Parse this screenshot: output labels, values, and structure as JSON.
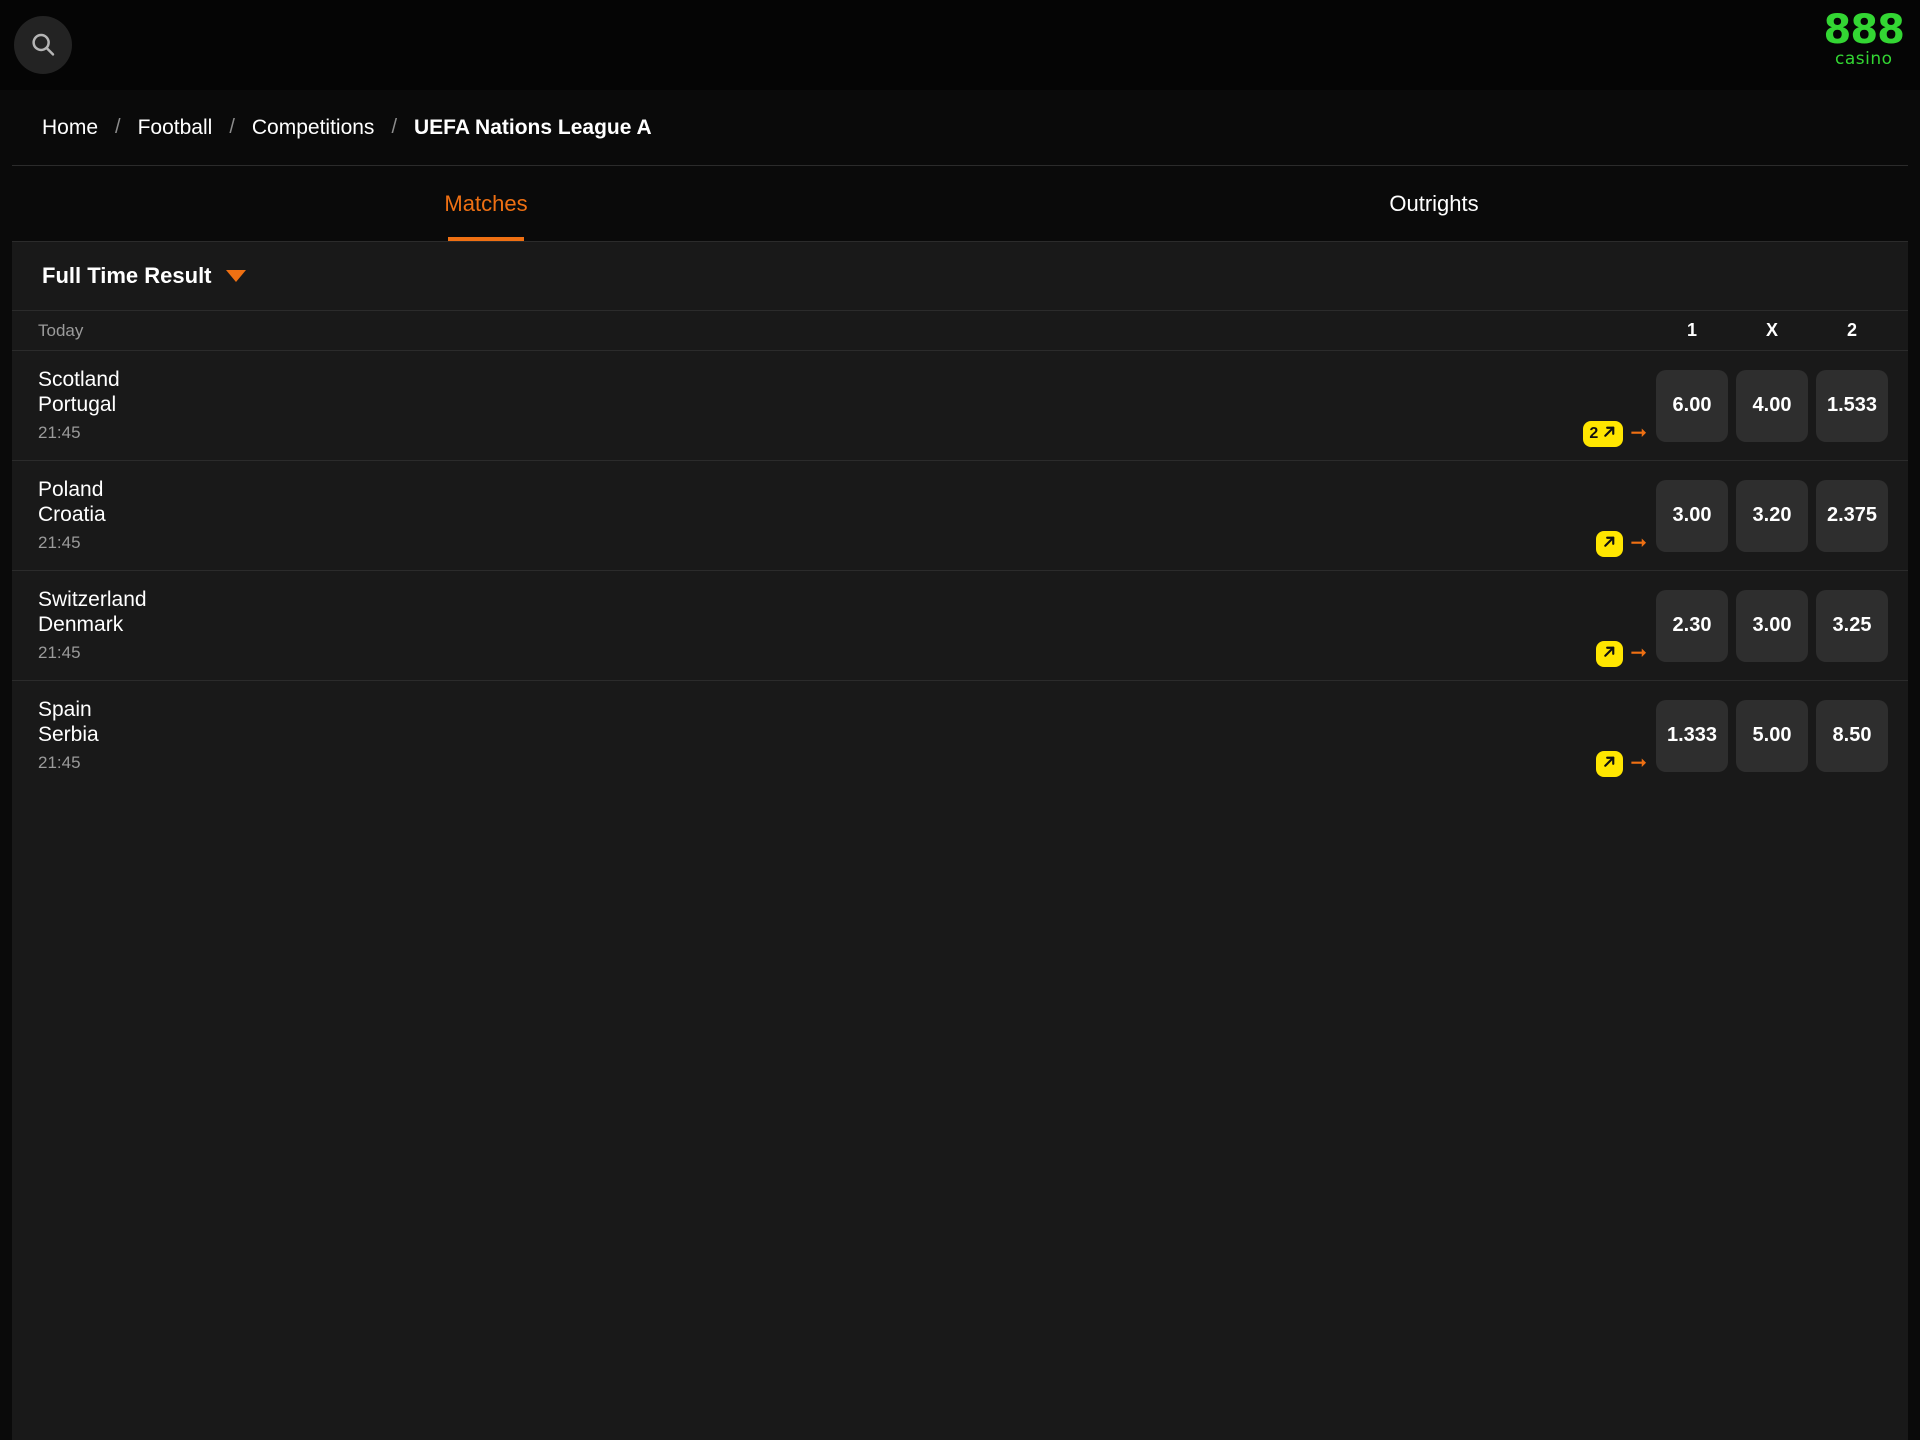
{
  "topbar": {
    "search_icon": "search-icon",
    "brand_main": "888",
    "brand_sub": "casino",
    "brand_color": "#33d633"
  },
  "breadcrumb": {
    "separator": "/",
    "items": [
      {
        "label": "Home",
        "current": false
      },
      {
        "label": "Football",
        "current": false
      },
      {
        "label": "Competitions",
        "current": false
      },
      {
        "label": "UEFA Nations League A",
        "current": true
      }
    ]
  },
  "tabs": [
    {
      "label": "Matches",
      "active": true
    },
    {
      "label": "Outrights",
      "active": false
    }
  ],
  "market": {
    "title": "Full Time Result",
    "caret_icon": "chevron-down-icon",
    "accent_color": "#ef7013"
  },
  "day_group": {
    "label": "Today",
    "columns": [
      "1",
      "X",
      "2"
    ]
  },
  "matches": [
    {
      "home": "Scotland",
      "away": "Portugal",
      "time": "21:45",
      "badge_count": "2",
      "badge_icon": "arrow-north-east-icon",
      "more_icon": "arrow-right-icon",
      "odds": [
        "6.00",
        "4.00",
        "1.533"
      ]
    },
    {
      "home": "Poland",
      "away": "Croatia",
      "time": "21:45",
      "badge_count": "",
      "badge_icon": "arrow-north-east-icon",
      "more_icon": "arrow-right-icon",
      "odds": [
        "3.00",
        "3.20",
        "2.375"
      ]
    },
    {
      "home": "Switzerland",
      "away": "Denmark",
      "time": "21:45",
      "badge_count": "",
      "badge_icon": "arrow-north-east-icon",
      "more_icon": "arrow-right-icon",
      "odds": [
        "2.30",
        "3.00",
        "3.25"
      ]
    },
    {
      "home": "Spain",
      "away": "Serbia",
      "time": "21:45",
      "badge_count": "",
      "badge_icon": "arrow-north-east-icon",
      "more_icon": "arrow-right-icon",
      "odds": [
        "1.333",
        "5.00",
        "8.50"
      ]
    }
  ]
}
